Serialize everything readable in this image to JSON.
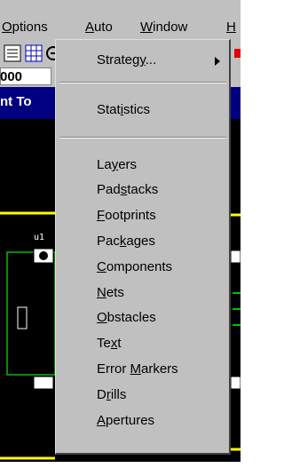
{
  "menubar": {
    "items": [
      {
        "pre": "",
        "u": "O",
        "post": "ptions"
      },
      {
        "pre": "",
        "u": "A",
        "post": "uto"
      },
      {
        "pre": "",
        "u": "W",
        "post": "indow"
      },
      {
        "pre": "",
        "u": "H",
        "post": ""
      }
    ]
  },
  "toolbar": {
    "number_field_value": "000"
  },
  "window": {
    "title_fragment": "nt To"
  },
  "canvas": {
    "component_label": "u1"
  },
  "menu": {
    "strategy": {
      "pre": "Strateg",
      "u": "y",
      "post": "..."
    },
    "statistics": {
      "pre": "Stat",
      "u": "i",
      "post": "stics"
    },
    "items": [
      {
        "pre": "La",
        "u": "y",
        "post": "ers"
      },
      {
        "pre": "Pad",
        "u": "s",
        "post": "tacks"
      },
      {
        "pre": "",
        "u": "F",
        "post": "ootprints"
      },
      {
        "pre": "Pac",
        "u": "k",
        "post": "ages"
      },
      {
        "pre": "",
        "u": "C",
        "post": "omponents"
      },
      {
        "pre": "",
        "u": "N",
        "post": "ets"
      },
      {
        "pre": "",
        "u": "O",
        "post": "bstacles"
      },
      {
        "pre": "Te",
        "u": "x",
        "post": "t"
      },
      {
        "pre": "Error ",
        "u": "M",
        "post": "arkers"
      },
      {
        "pre": "D",
        "u": "r",
        "post": "ills"
      },
      {
        "pre": "",
        "u": "A",
        "post": "pertures"
      }
    ]
  },
  "colors": {
    "face": "#c0c0c0",
    "title": "#000080",
    "canvas": "#000000",
    "trace_yellow": "#ffff00",
    "trace_green": "#00c000"
  }
}
